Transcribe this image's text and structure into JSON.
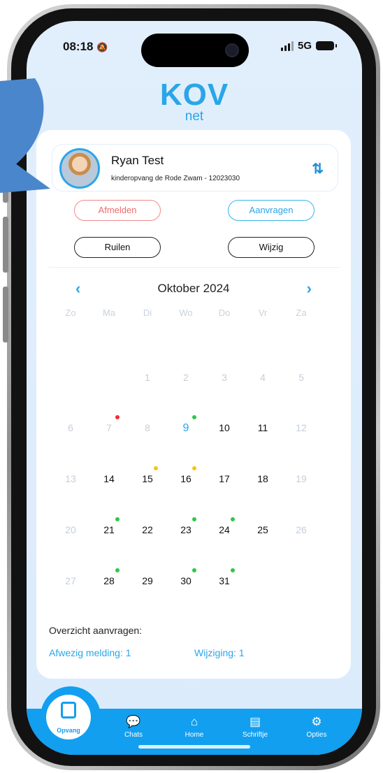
{
  "status_bar": {
    "time": "08:18",
    "network": "5G"
  },
  "logo": {
    "main": "KOV",
    "sub": "net"
  },
  "child": {
    "name": "Ryan Test",
    "location": "kinderopvang de Rode Zwam - 12023030"
  },
  "actions": {
    "afmelden": "Afmelden",
    "aanvragen": "Aanvragen",
    "ruilen": "Ruilen",
    "wijzig": "Wijzig"
  },
  "calendar": {
    "month": "Oktober 2024",
    "weekdays": [
      "Zo",
      "Ma",
      "Di",
      "Wo",
      "Do",
      "Vr",
      "Za"
    ],
    "weeks": [
      [
        "",
        "",
        "1",
        "2",
        "3",
        "4",
        "5"
      ],
      [
        "6",
        "7",
        "8",
        "9",
        "10",
        "11",
        "12"
      ],
      [
        "13",
        "14",
        "15",
        "16",
        "17",
        "18",
        "19"
      ],
      [
        "20",
        "21",
        "22",
        "23",
        "24",
        "25",
        "26"
      ],
      [
        "27",
        "28",
        "29",
        "30",
        "31",
        "",
        ""
      ]
    ],
    "muted_days": [
      "1",
      "2",
      "3",
      "4",
      "5",
      "6",
      "7",
      "8",
      "12",
      "13",
      "19",
      "20",
      "26",
      "27"
    ],
    "today": "9",
    "markers": [
      {
        "day": "7",
        "color": "#f02d3a"
      },
      {
        "day": "9",
        "color": "#2ec74a"
      },
      {
        "day": "15",
        "color": "#f5c518"
      },
      {
        "day": "16",
        "color": "#f5c518"
      },
      {
        "day": "21",
        "color": "#2ec74a"
      },
      {
        "day": "23",
        "color": "#2ec74a"
      },
      {
        "day": "24",
        "color": "#2ec74a"
      },
      {
        "day": "28",
        "color": "#2ec74a"
      },
      {
        "day": "30",
        "color": "#2ec74a"
      },
      {
        "day": "31",
        "color": "#2ec74a"
      }
    ]
  },
  "overview": {
    "title": "Overzicht aanvragen:",
    "absent": "Afwezig melding: 1",
    "change": "Wijziging: 1"
  },
  "tabs": [
    {
      "label": "Opvang",
      "icon": "calendar-icon",
      "active": true
    },
    {
      "label": "Chats",
      "icon": "chat-bubble-icon"
    },
    {
      "label": "Home",
      "icon": "home-icon"
    },
    {
      "label": "Schriftje",
      "icon": "book-icon"
    },
    {
      "label": "Opties",
      "icon": "gear-icon"
    }
  ],
  "colors": {
    "accent": "#2aa6e8",
    "tabbar": "#129ff0",
    "afmelden": "#f06a6a",
    "arrow": "#4a86cc"
  }
}
